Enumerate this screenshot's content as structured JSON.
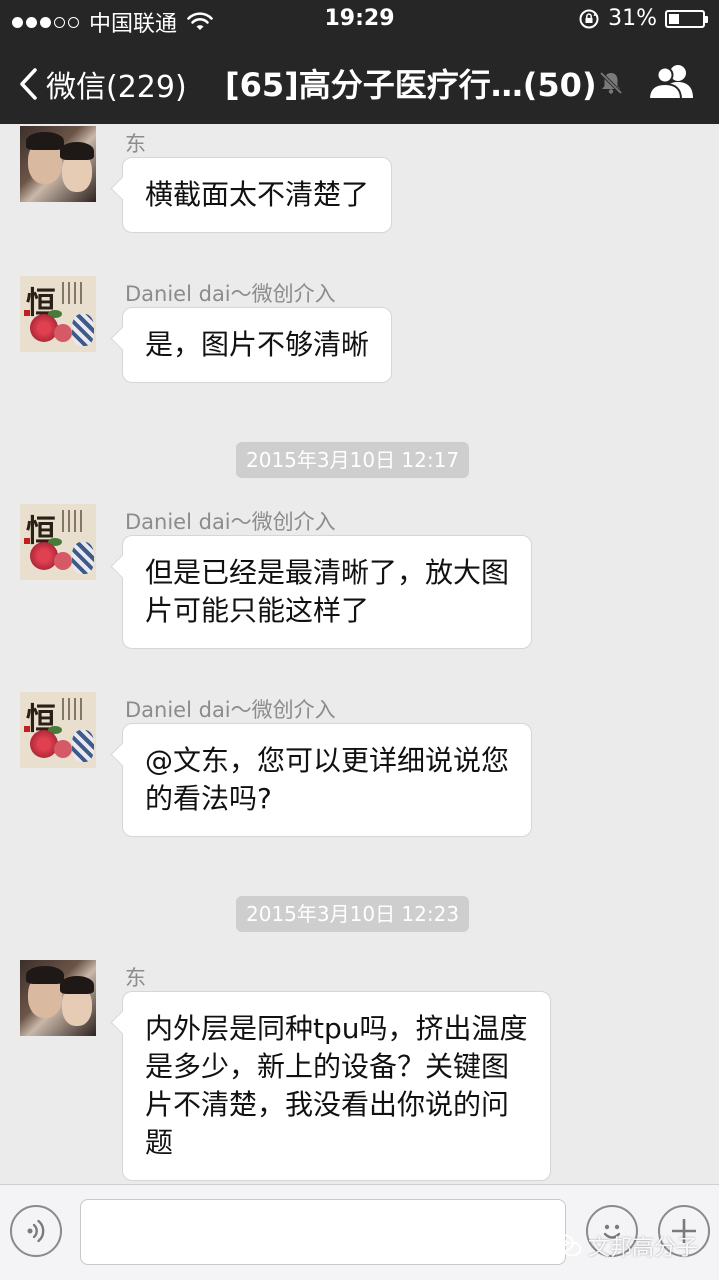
{
  "status_bar": {
    "signal_filled": 3,
    "signal_total": 5,
    "carrier": "中国联通",
    "time": "19:29",
    "battery_text": "31%",
    "battery_level": 0.31
  },
  "nav": {
    "back_label": "微信(229)",
    "title": "[65]高分子医疗行…(50)",
    "icons": [
      "back-chevron-icon",
      "mute-bell-icon",
      "group-contacts-icon"
    ]
  },
  "messages": [
    {
      "kind": "message",
      "sender": "东",
      "avatar": "dong",
      "text": "横截面太不清楚了"
    },
    {
      "kind": "message",
      "sender": "Daniel dai～微创介入",
      "avatar": "heng",
      "text": "是，图片不够清晰"
    },
    {
      "kind": "timestamp",
      "text": "2015年3月10日  12:17"
    },
    {
      "kind": "message",
      "sender": "Daniel dai～微创介入",
      "avatar": "heng",
      "text": "但是已经是最清晰了，放大图\n片可能只能这样了"
    },
    {
      "kind": "message",
      "sender": "Daniel dai～微创介入",
      "avatar": "heng",
      "text": "@文东，您可以更详细说说您\n的看法吗?"
    },
    {
      "kind": "timestamp",
      "text": "2015年3月10日  12:23"
    },
    {
      "kind": "message",
      "sender": "东",
      "avatar": "dong",
      "text": "内外层是同种tpu吗，挤出温度\n是多少，新上的设备？关键图\n片不清楚，我没看出你说的问\n题"
    }
  ],
  "input_bar": {
    "text_value": "",
    "icons": [
      "voice-icon",
      "emoji-icon",
      "plus-icon"
    ]
  },
  "watermark": {
    "text": "文邦高分子",
    "icon": "wechat-icon"
  }
}
